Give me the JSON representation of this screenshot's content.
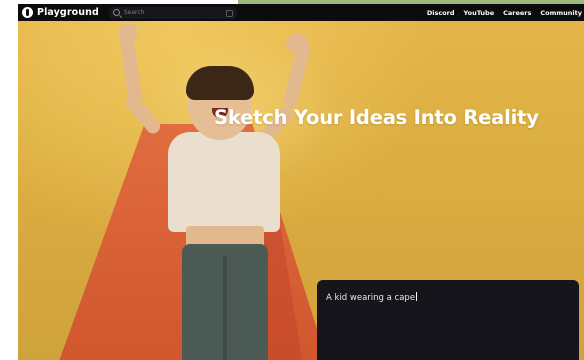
{
  "navbar": {
    "brand": "Playground",
    "search_placeholder": "Search",
    "links": [
      "Discord",
      "YouTube",
      "Careers",
      "Community"
    ]
  },
  "hero": {
    "title": "Sketch Your Ideas Into Reality"
  },
  "prompt": {
    "value": "A kid wearing a cape"
  },
  "colors": {
    "navbar_bg": "#0c0c0f",
    "hero_bg": "#ddb043",
    "panel_bg": "#15151b",
    "title_text": "#ffffff"
  }
}
